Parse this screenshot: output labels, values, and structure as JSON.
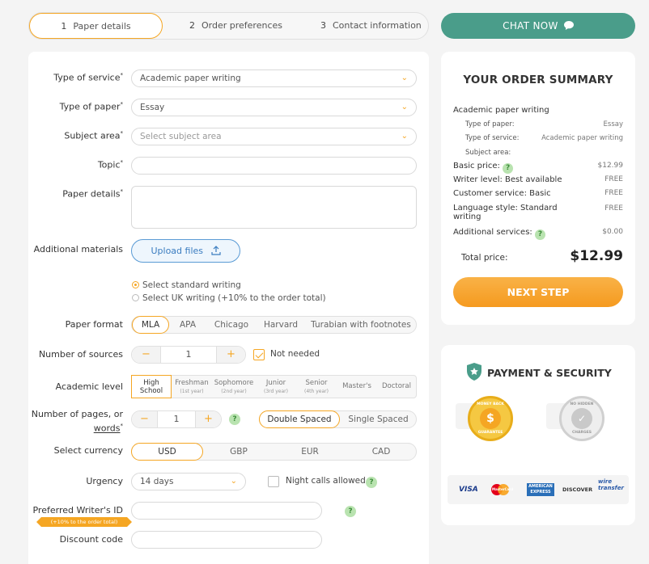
{
  "steps": [
    {
      "num": "1",
      "label": "Paper details"
    },
    {
      "num": "2",
      "label": "Order preferences"
    },
    {
      "num": "3",
      "label": "Contact information"
    }
  ],
  "chat": {
    "label": "CHAT NOW"
  },
  "form": {
    "type_of_service": {
      "label": "Type of service",
      "value": "Academic paper writing"
    },
    "type_of_paper": {
      "label": "Type of paper",
      "value": "Essay"
    },
    "subject_area": {
      "label": "Subject area",
      "placeholder": "Select subject area"
    },
    "topic": {
      "label": "Topic",
      "value": ""
    },
    "paper_details": {
      "label": "Paper details",
      "value": ""
    },
    "additional_materials": {
      "label": "Additional materials",
      "button": "Upload files"
    },
    "writing_options": [
      "Select standard writing",
      "Select UK writing (+10% to the order total)"
    ],
    "paper_format": {
      "label": "Paper format",
      "options": [
        "MLA",
        "APA",
        "Chicago",
        "Harvard",
        "Turabian with footnotes"
      ]
    },
    "sources": {
      "label": "Number of sources",
      "value": "1",
      "not_needed": "Not needed"
    },
    "academic_level": {
      "label": "Academic level",
      "options": [
        {
          "name": "High School",
          "sub": ""
        },
        {
          "name": "Freshman",
          "sub": "(1st year)"
        },
        {
          "name": "Sophomore",
          "sub": "(2nd year)"
        },
        {
          "name": "Junior",
          "sub": "(3rd year)"
        },
        {
          "name": "Senior",
          "sub": "(4th year)"
        },
        {
          "name": "Master's",
          "sub": ""
        },
        {
          "name": "Doctoral",
          "sub": ""
        }
      ]
    },
    "pages": {
      "label": "Number of pages, or",
      "label_link": "words",
      "value": "1",
      "spacing": [
        "Double Spaced",
        "Single Spaced"
      ]
    },
    "currency": {
      "label": "Select currency",
      "options": [
        "USD",
        "GBP",
        "EUR",
        "CAD"
      ]
    },
    "urgency": {
      "label": "Urgency",
      "value": "14 days",
      "night_calls": "Night calls allowed"
    },
    "preferred_writer": {
      "label": "Preferred Writer's ID",
      "badge": "(+10% to the order total)",
      "value": ""
    },
    "discount": {
      "label": "Discount code",
      "value": ""
    }
  },
  "summary": {
    "title": "YOUR ORDER SUMMARY",
    "service": "Academic paper writing",
    "type_of_paper_label": "Type of paper:",
    "type_of_paper_value": "Essay",
    "type_of_service_label": "Type of service:",
    "type_of_service_value": "Academic paper writing",
    "subject_area_label": "Subject area:",
    "basic_price_label": "Basic price:",
    "basic_price_value": "$12.99",
    "writer_level_label": "Writer level: Best available",
    "writer_level_value": "FREE",
    "customer_service_label": "Customer service: Basic",
    "customer_service_value": "FREE",
    "language_style_label": "Language style: Standard writing",
    "language_style_value": "FREE",
    "additional_services_label": "Additional services:",
    "additional_services_value": "$0.00",
    "total_label": "Total price:",
    "total_value": "$12.99",
    "next_step": "NEXT STEP"
  },
  "security": {
    "title": "PAYMENT & SECURITY",
    "seal_money_back": "MONEY BACK",
    "seal_guarantee": "GUARANTEE",
    "seal_no_hidden": "NO HIDDEN",
    "seal_charges": "CHARGES",
    "payment_methods": [
      "VISA",
      "MasterCard",
      "AMERICAN EXPRESS",
      "DISCOVER",
      "wire transfer"
    ]
  },
  "colors": {
    "accent": "#f5a623",
    "chat": "#4a9d8a",
    "link": "#3a7cc0",
    "help": "#b9e3b0"
  }
}
